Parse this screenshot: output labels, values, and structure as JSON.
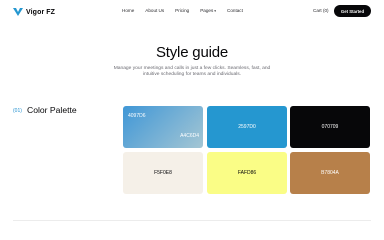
{
  "nav": {
    "logo_text": "Vigor FZ",
    "menu": [
      {
        "label": "Home"
      },
      {
        "label": "About Us"
      },
      {
        "label": "Pricing"
      },
      {
        "label": "Pages"
      },
      {
        "label": "Contact"
      }
    ],
    "cart_label": "Cart (0)",
    "cta_label": "Get Started"
  },
  "hero": {
    "title": "Style guide",
    "subtitle": "Manage your meetings and calls in just a few clicks. Seamless, fast, and intuitive scheduling for teams and individuals."
  },
  "section": {
    "number": "(01)",
    "title": "Color Palette"
  },
  "palette": [
    {
      "label_a": "4097D6",
      "label_b": "A4C6D4",
      "color_a": "#4097D6",
      "color_b": "#A4C6D4"
    },
    {
      "label": "2597D0",
      "color": "#2597D0"
    },
    {
      "label": "070709",
      "color": "#070709"
    },
    {
      "label": "F5F0E8",
      "color": "#F5F0E8"
    },
    {
      "label": "FAFD86",
      "color": "#FAFD86"
    },
    {
      "label": "B7804A",
      "color": "#B7804A"
    }
  ],
  "colors": {
    "accent": "#2591D0",
    "cta_background": "#070709"
  }
}
